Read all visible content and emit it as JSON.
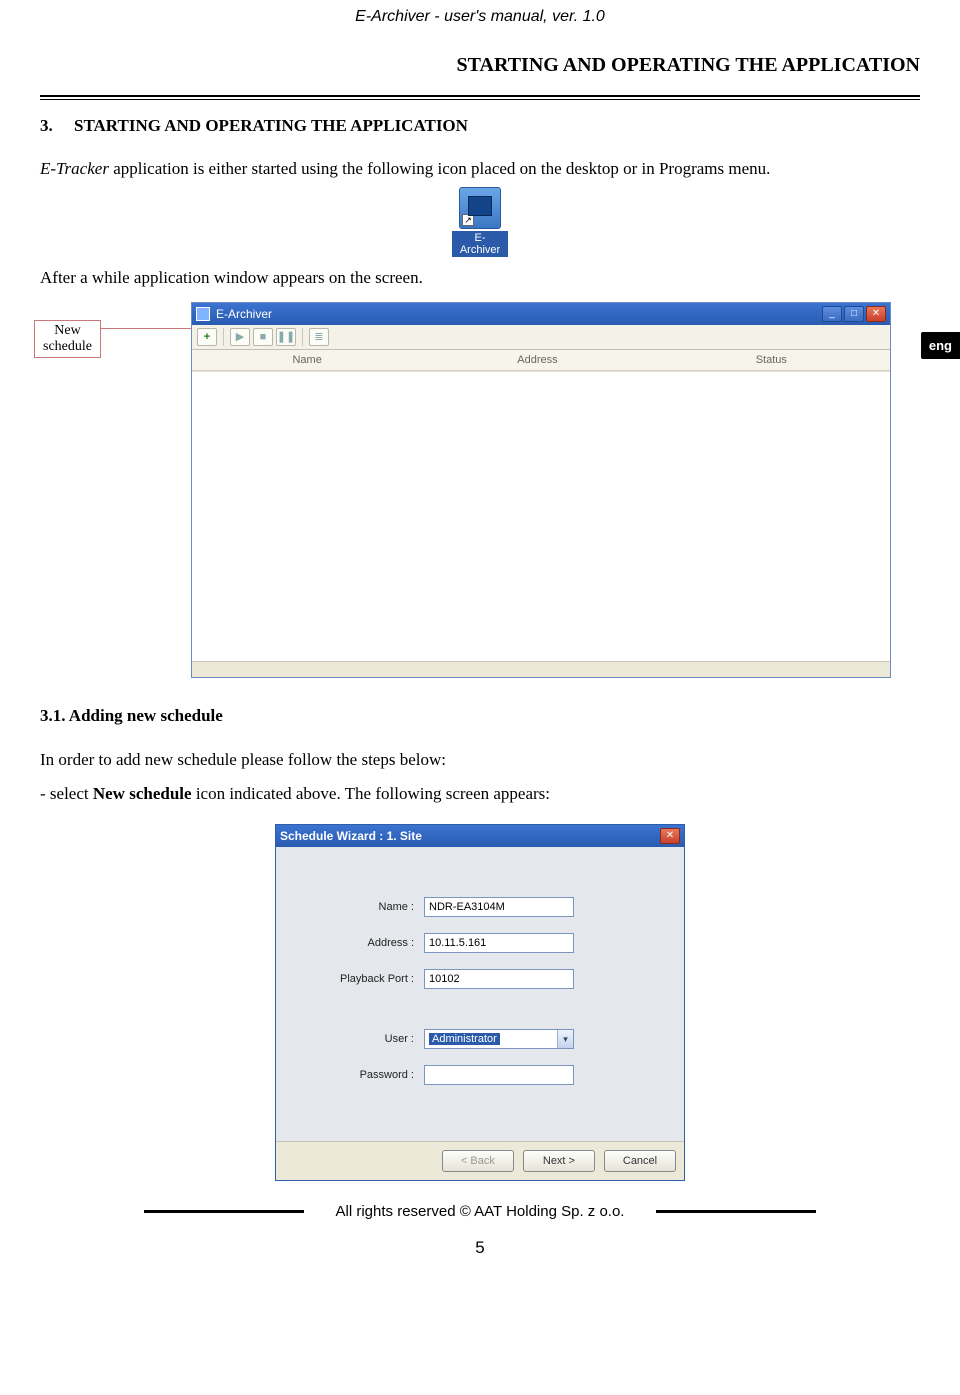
{
  "doc_header": "E-Archiver - user's manual, ver. 1.0",
  "chapter_title": "STARTING AND OPERATING THE APPLICATION",
  "section_number": "3.",
  "section_title": "STARTING AND OPERATING THE APPLICATION",
  "intro": {
    "app_name": "E-Tracker",
    "rest": " application is either started using the following icon placed on the desktop or in Programs menu."
  },
  "desktop_icon_label": "E-Archiver",
  "after_while_text": "After a while application window appears on the screen.",
  "lang_tab": "eng",
  "callout": {
    "line1": "New",
    "line2": "schedule"
  },
  "app_window": {
    "title": "E-Archiver",
    "toolbar": {
      "add": "+",
      "play": "▶",
      "stop": "■",
      "pause": "❚❚",
      "list": "≣"
    },
    "columns": {
      "name": "Name",
      "address": "Address",
      "status": "Status"
    }
  },
  "subsection_heading": "3.1. Adding new schedule",
  "steps_intro": "In order to add new schedule please follow the steps below:",
  "step1": {
    "prefix": "- select ",
    "bold": "New schedule",
    "rest": " icon indicated above. The following screen appears:"
  },
  "wizard": {
    "title": "Schedule Wizard : 1. Site",
    "fields": {
      "name_label": "Name :",
      "name_value": "NDR-EA3104M",
      "address_label": "Address :",
      "address_value": "10.11.5.161",
      "port_label": "Playback Port :",
      "port_value": "10102",
      "user_label": "User :",
      "user_value": "Administrator",
      "password_label": "Password :",
      "password_value": ""
    },
    "buttons": {
      "back": "< Back",
      "next": "Next >",
      "cancel": "Cancel"
    }
  },
  "footer_text": "All rights reserved © AAT Holding Sp. z o.o.",
  "page_number": "5"
}
